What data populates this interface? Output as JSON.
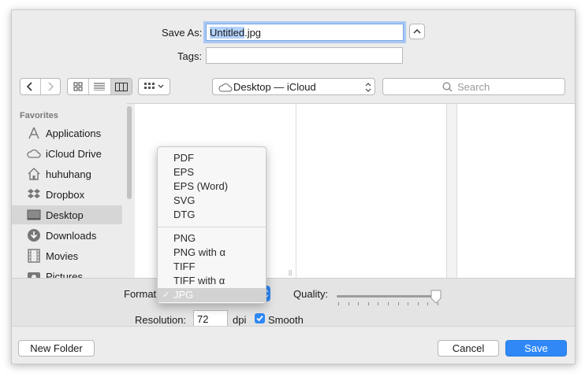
{
  "save_as": {
    "label": "Save As:",
    "filename": "Untitled.jpg",
    "selected_part": "Untitled",
    "extension": ".jpg"
  },
  "tags": {
    "label": "Tags:",
    "value": ""
  },
  "toolbar": {
    "location": "Desktop — iCloud",
    "search_placeholder": "Search"
  },
  "sidebar": {
    "heading": "Favorites",
    "items": [
      {
        "label": "Applications",
        "icon": "applications-icon"
      },
      {
        "label": "iCloud Drive",
        "icon": "icloud-icon"
      },
      {
        "label": "huhuhang",
        "icon": "home-icon"
      },
      {
        "label": "Dropbox",
        "icon": "dropbox-icon"
      },
      {
        "label": "Desktop",
        "icon": "desktop-icon",
        "active": true
      },
      {
        "label": "Downloads",
        "icon": "downloads-icon"
      },
      {
        "label": "Movies",
        "icon": "movies-icon"
      },
      {
        "label": "Pictures",
        "icon": "pictures-icon"
      }
    ]
  },
  "options": {
    "format_label": "Format",
    "quality_label": "Quality:",
    "quality_level": 0.97,
    "resolution_label": "Resolution:",
    "resolution_value": "72",
    "resolution_unit": "dpi",
    "smooth_label": "Smooth",
    "smooth_checked": true
  },
  "format_menu": {
    "group1": [
      "PDF",
      "EPS",
      "EPS (Word)",
      "SVG",
      "DTG"
    ],
    "group2": [
      "PNG",
      "PNG with α",
      "TIFF",
      "TIFF with α",
      "JPG"
    ],
    "selected": "JPG",
    "check": "✓"
  },
  "footer": {
    "new_folder": "New Folder",
    "cancel": "Cancel",
    "save": "Save"
  },
  "colors": {
    "accent": "#2f88f6",
    "selection": "#b3d2fb"
  }
}
